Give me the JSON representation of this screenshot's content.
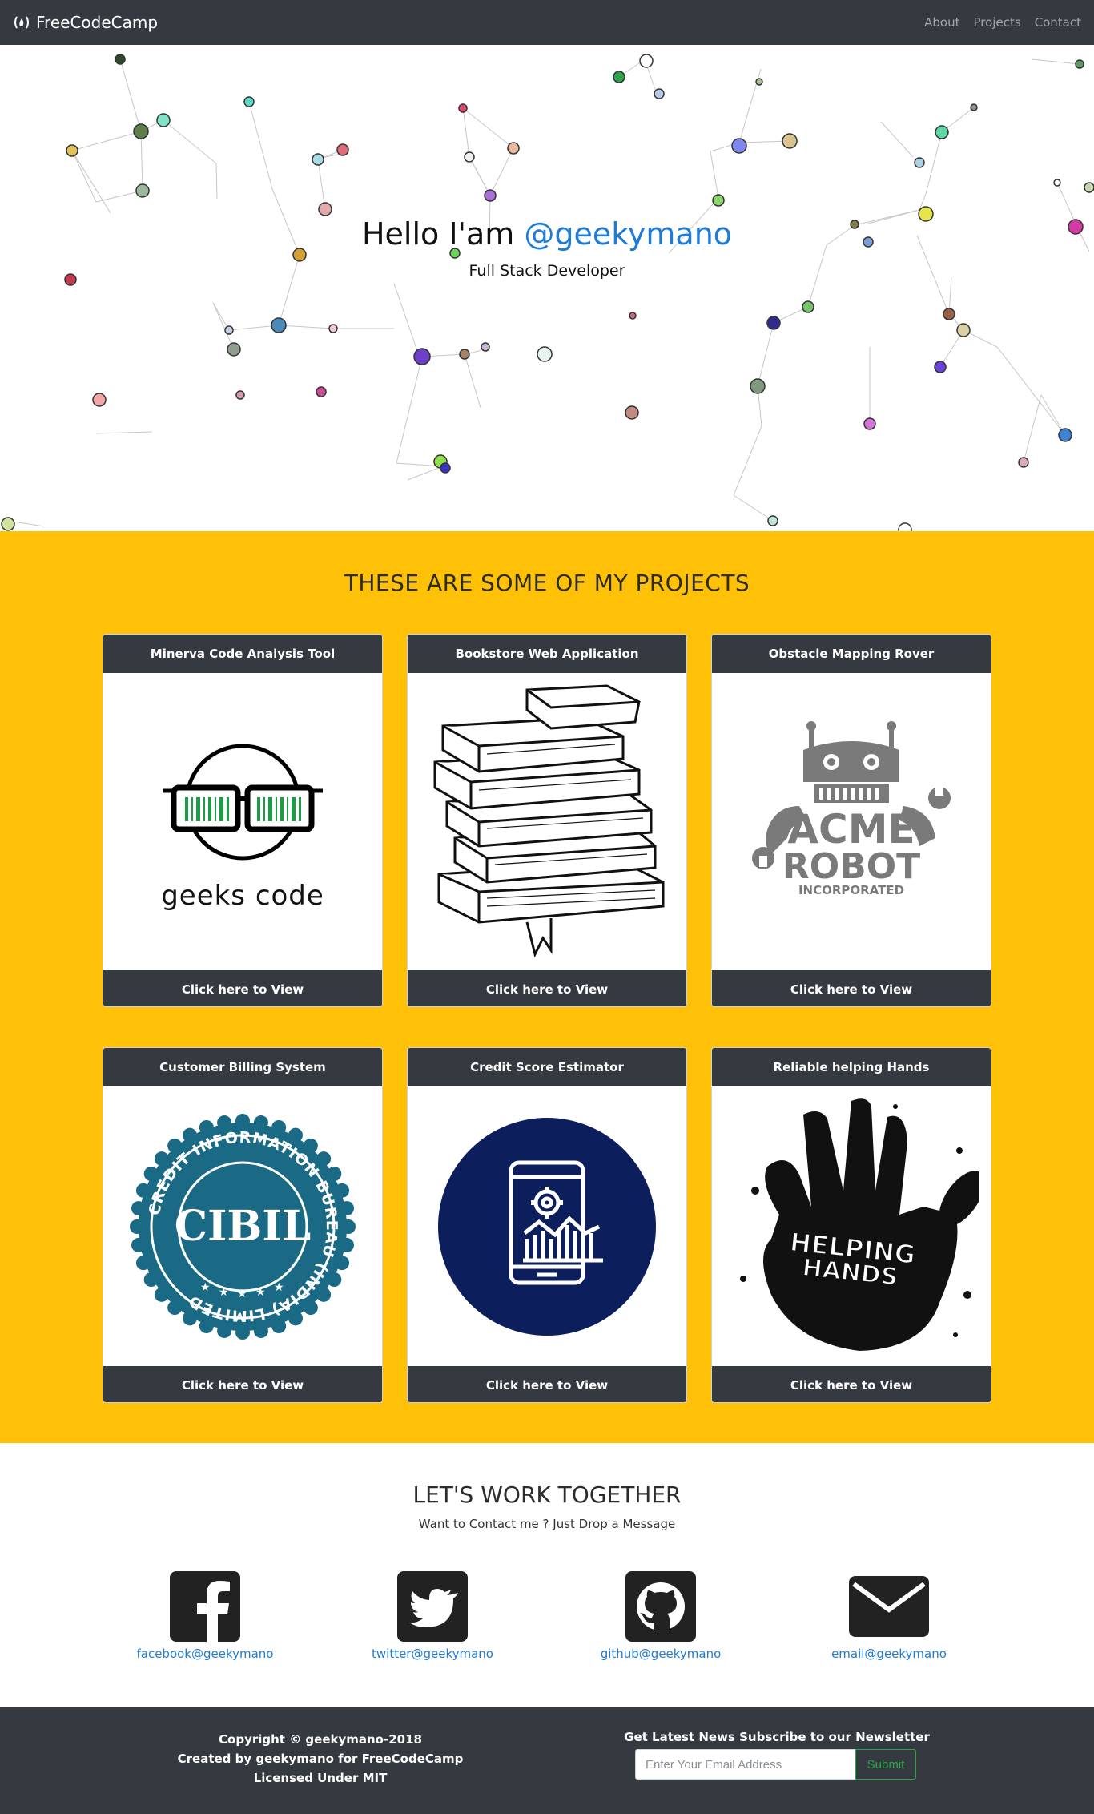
{
  "navbar": {
    "brand": "FreeCodeCamp",
    "links": [
      "About",
      "Projects",
      "Contact"
    ]
  },
  "hero": {
    "greeting": "Hello I'am ",
    "handle": "@geekymano",
    "subtitle": "Full Stack Developer"
  },
  "projects": {
    "title": "THESE ARE SOME OF MY PROJECTS",
    "cards": [
      {
        "title": "Minerva Code Analysis Tool",
        "cta": "Click here to View",
        "image_text": "geeks code"
      },
      {
        "title": "Bookstore Web Application",
        "cta": "Click here to View"
      },
      {
        "title": "Obstacle Mapping Rover",
        "cta": "Click here to View",
        "image_text_1": "ACME",
        "image_text_2": "ROBOT",
        "image_text_3": "INCORPORATED"
      },
      {
        "title": "Customer Billing System",
        "cta": "Click here to View",
        "image_text": "CIBIL",
        "image_ring_text": "CREDIT INFORMATION BUREAU (INDIA) LIMITED"
      },
      {
        "title": "Credit Score Estimator",
        "cta": "Click here to View"
      },
      {
        "title": "Reliable helping Hands",
        "cta": "Click here to View",
        "image_text_1": "HELPING",
        "image_text_2": "HANDS"
      }
    ]
  },
  "contact": {
    "title": "LET'S WORK TOGETHER",
    "subtitle": "Want to Contact me ? Just Drop a Message",
    "links": [
      {
        "label": "facebook@geekymano",
        "icon": "facebook-icon"
      },
      {
        "label": "twitter@geekymano",
        "icon": "twitter-icon"
      },
      {
        "label": "github@geekymano",
        "icon": "github-icon"
      },
      {
        "label": "email@geekymano",
        "icon": "email-icon"
      }
    ]
  },
  "footer": {
    "copyright": "Copyright © geekymano-2018",
    "created": "Created by geekymano for FreeCodeCamp",
    "license": "Licensed Under MIT",
    "newsletter_heading": "Get Latest News Subscribe to our Newsletter",
    "email_placeholder": "Enter Your Email Address",
    "submit_label": "Submit"
  },
  "colors": {
    "navbar": "#343a40",
    "projects_bg": "#ffc107",
    "link": "#1e7bd8",
    "submit": "#28a745"
  }
}
